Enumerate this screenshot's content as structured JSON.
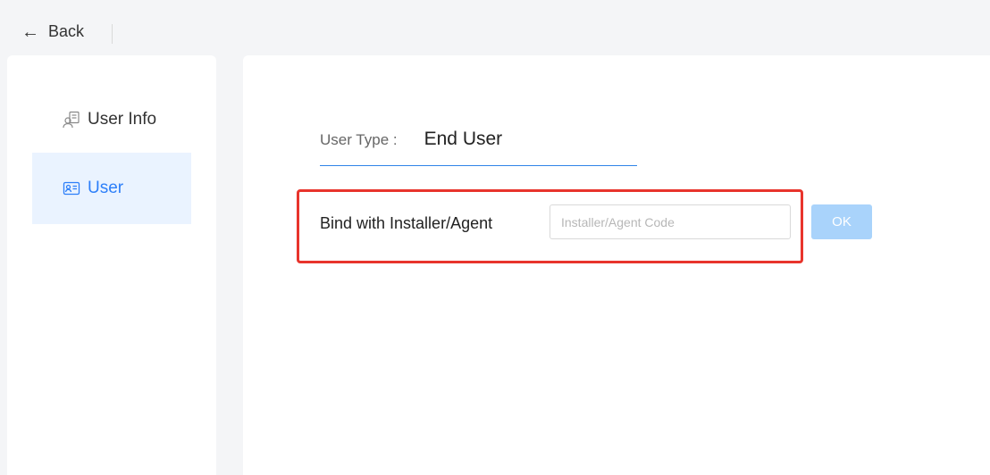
{
  "topbar": {
    "back_label": "Back"
  },
  "sidebar": {
    "items": [
      {
        "label": "User Info",
        "icon": "user-card-icon",
        "active": false
      },
      {
        "label": "User",
        "icon": "id-card-icon",
        "active": true
      }
    ]
  },
  "main": {
    "user_type": {
      "label": "User Type :",
      "value": "End User"
    },
    "bind": {
      "label": "Bind with Installer/Agent",
      "input_placeholder": "Installer/Agent Code",
      "input_value": "",
      "ok_label": "OK"
    }
  },
  "colors": {
    "accent": "#2d7ff9",
    "active_bg": "#eaf3ff",
    "highlight_border": "#e8342c",
    "ok_button_bg": "#a9d3fb"
  }
}
